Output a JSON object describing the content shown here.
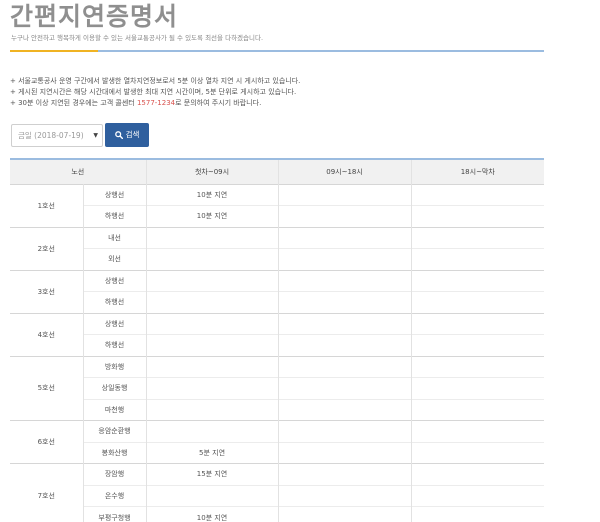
{
  "header": {
    "title": "간편지연증명서",
    "subtitle": "누구나 안전하고 행복하게 이용할 수 있는 서울교통공사가 될 수 있도록 최선을 다하겠습니다."
  },
  "notes": {
    "line1": "+ 서울교통공사 운영 구간에서 발생한 열차지연정보로서 5분 이상 열차 지연 시 게시하고 있습니다.",
    "line2": "+ 게시된 지연시간은 해당 시간대에서 발생한 최대 지연 시간이며, 5분 단위로 게시하고 있습니다.",
    "line3_before": "+ 30분 이상 지연된 경우에는 고객 콜센터 ",
    "line3_phone": "1577-1234",
    "line3_after": "로 문의하여 주시기 바랍니다."
  },
  "filter": {
    "date_value": "금일 (2018-07-19)",
    "search_label": "검색"
  },
  "table": {
    "headers": [
      "노선",
      "첫차~09시",
      "09시~18시",
      "18시~막차"
    ],
    "rows": [
      {
        "line": "1호선",
        "direction": "상행선",
        "first_to_09": "10분 지연",
        "h09_to_18": "",
        "h18_to_last": ""
      },
      {
        "line": "",
        "direction": "하행선",
        "first_to_09": "10분 지연",
        "h09_to_18": "",
        "h18_to_last": ""
      },
      {
        "line": "2호선",
        "direction": "내선",
        "first_to_09": "",
        "h09_to_18": "",
        "h18_to_last": ""
      },
      {
        "line": "",
        "direction": "외선",
        "first_to_09": "",
        "h09_to_18": "",
        "h18_to_last": ""
      },
      {
        "line": "3호선",
        "direction": "상행선",
        "first_to_09": "",
        "h09_to_18": "",
        "h18_to_last": ""
      },
      {
        "line": "",
        "direction": "하행선",
        "first_to_09": "",
        "h09_to_18": "",
        "h18_to_last": ""
      },
      {
        "line": "4호선",
        "direction": "상행선",
        "first_to_09": "",
        "h09_to_18": "",
        "h18_to_last": ""
      },
      {
        "line": "",
        "direction": "하행선",
        "first_to_09": "",
        "h09_to_18": "",
        "h18_to_last": ""
      },
      {
        "line": "",
        "direction": "방화행",
        "first_to_09": "",
        "h09_to_18": "",
        "h18_to_last": ""
      },
      {
        "line": "5호선",
        "direction": "상일동행",
        "first_to_09": "",
        "h09_to_18": "",
        "h18_to_last": ""
      },
      {
        "line": "",
        "direction": "마천행",
        "first_to_09": "",
        "h09_to_18": "",
        "h18_to_last": ""
      },
      {
        "line": "6호선",
        "direction": "응암순환행",
        "first_to_09": "",
        "h09_to_18": "",
        "h18_to_last": ""
      },
      {
        "line": "",
        "direction": "봉화산행",
        "first_to_09": "5분 지연",
        "h09_to_18": "",
        "h18_to_last": ""
      },
      {
        "line": "",
        "direction": "장암행",
        "first_to_09": "15분 지연",
        "h09_to_18": "",
        "h18_to_last": ""
      },
      {
        "line": "7호선",
        "direction": "온수행",
        "first_to_09": "",
        "h09_to_18": "",
        "h18_to_last": ""
      },
      {
        "line": "",
        "direction": "부평구청행",
        "first_to_09": "10분 지연",
        "h09_to_18": "",
        "h18_to_last": ""
      }
    ]
  }
}
